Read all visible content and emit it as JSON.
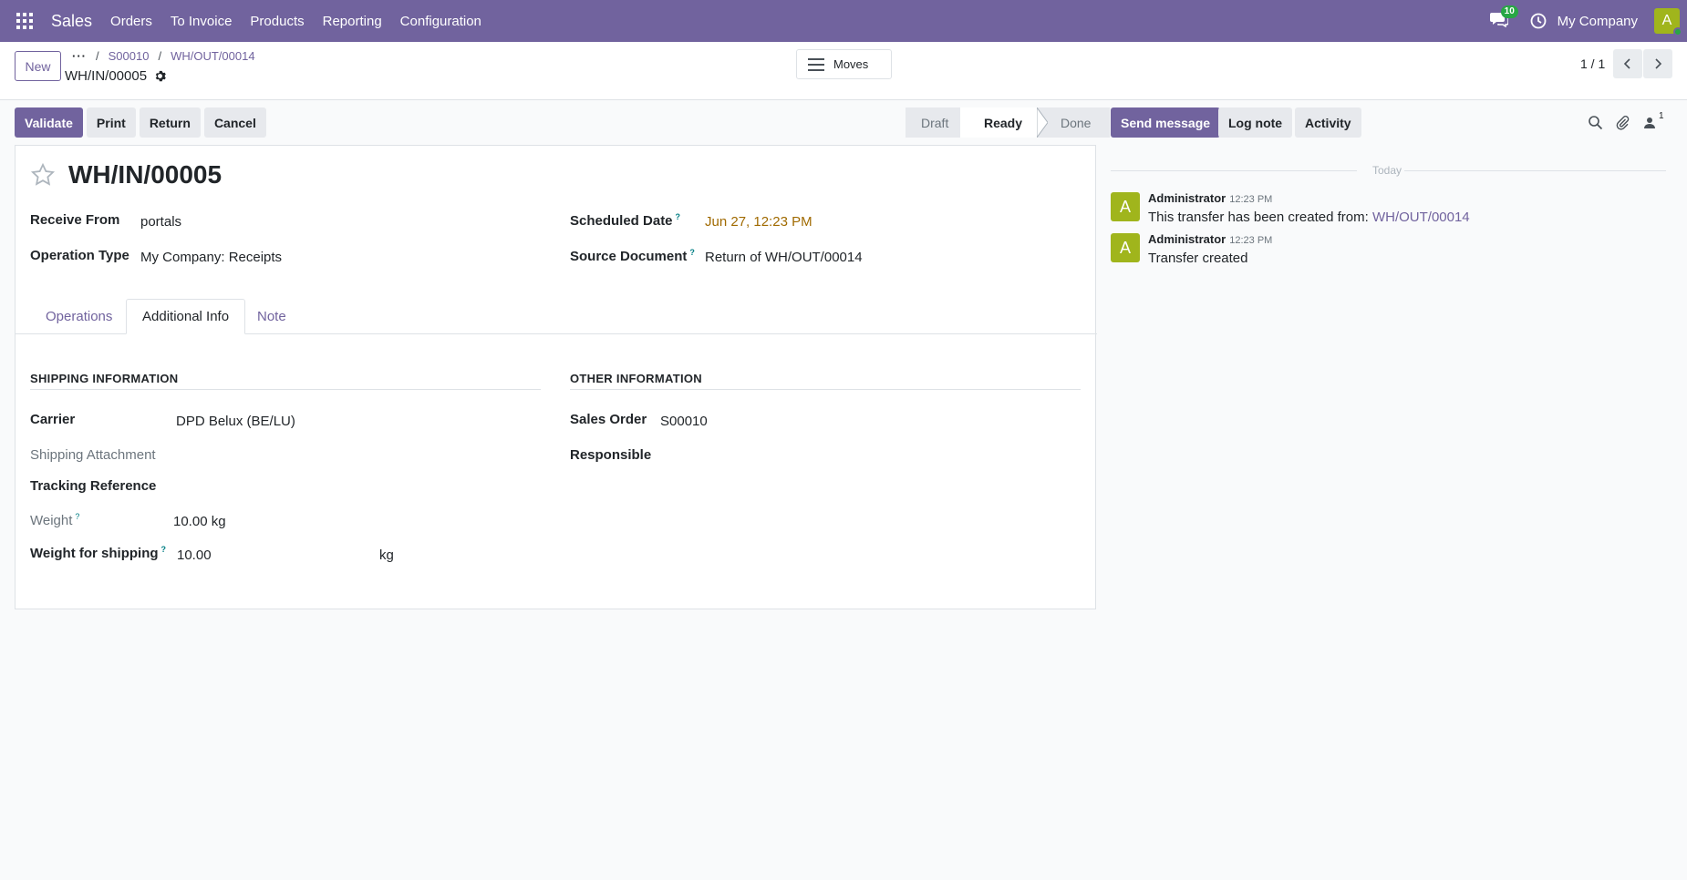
{
  "navbar": {
    "app_name": "Sales",
    "menu": [
      "Orders",
      "To Invoice",
      "Products",
      "Reporting",
      "Configuration"
    ],
    "messages_count": "10",
    "company": "My Company",
    "avatar_letter": "A"
  },
  "control": {
    "new_label": "New",
    "breadcrumb": [
      "S00010",
      "WH/OUT/00014"
    ],
    "record_name": "WH/IN/00005",
    "moves_label": "Moves",
    "pager": "1 / 1"
  },
  "actions": {
    "validate": "Validate",
    "print": "Print",
    "return": "Return",
    "cancel": "Cancel"
  },
  "stages": {
    "draft": "Draft",
    "ready": "Ready",
    "done": "Done",
    "current": "Ready"
  },
  "form": {
    "title": "WH/IN/00005",
    "receive_from_label": "Receive From",
    "receive_from": "portals",
    "operation_type_label": "Operation Type",
    "operation_type": "My Company: Receipts",
    "scheduled_date_label": "Scheduled Date",
    "scheduled_date": "Jun 27, 12:23 PM",
    "source_document_label": "Source Document",
    "source_document": "Return of WH/OUT/00014",
    "help_mark": "?"
  },
  "tabs": {
    "operations": "Operations",
    "additional_info": "Additional Info",
    "note": "Note",
    "active": "Additional Info"
  },
  "shipping": {
    "section_title": "SHIPPING INFORMATION",
    "carrier_label": "Carrier",
    "carrier": "DPD Belux (BE/LU)",
    "attachment_label": "Shipping Attachment",
    "tracking_label": "Tracking Reference",
    "weight_label": "Weight",
    "weight": "10.00",
    "weight_unit": "kg",
    "weight_shipping_label": "Weight for shipping",
    "weight_shipping": "10.00",
    "weight_shipping_unit": "kg"
  },
  "other": {
    "section_title": "OTHER INFORMATION",
    "sales_order_label": "Sales Order",
    "sales_order": "S00010",
    "responsible_label": "Responsible"
  },
  "chatter": {
    "send_message": "Send message",
    "log_note": "Log note",
    "activity": "Activity",
    "followers_count": "1",
    "day_separator": "Today",
    "messages": [
      {
        "avatar": "A",
        "author": "Administrator",
        "time": "12:23 PM",
        "body": "This transfer has been created from:",
        "link": "WH/OUT/00014"
      },
      {
        "avatar": "A",
        "author": "Administrator",
        "time": "12:23 PM",
        "body": "Transfer created",
        "link": ""
      }
    ]
  },
  "colors": {
    "brand": "#71639e",
    "avatar": "#a0b51c",
    "date": "#a06a00"
  }
}
